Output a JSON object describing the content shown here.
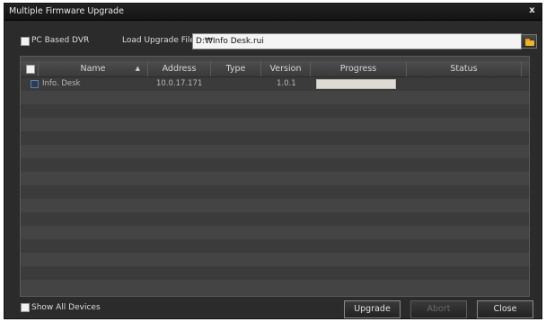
{
  "window": {
    "title": "Multiple Firmware Upgrade",
    "close_glyph": "x"
  },
  "options": {
    "pc_based_dvr_label": "PC Based DVR",
    "pc_based_dvr_checked": false,
    "load_file_label": "Load Upgrade File :",
    "load_file_value": "D:₩Info Desk.rui"
  },
  "table": {
    "columns": [
      "Name",
      "Address",
      "Type",
      "Version",
      "Progress",
      "Status"
    ],
    "rows": [
      {
        "name": "Info. Desk",
        "address": "10.0.17.171",
        "type": "",
        "version": "1.0.1",
        "progress": 0,
        "status": ""
      }
    ]
  },
  "footer": {
    "show_all_label": "Show All Devices",
    "show_all_checked": false,
    "upgrade_label": "Upgrade",
    "abort_label": "Abort",
    "close_label": "Close"
  },
  "icons": {
    "browse": "folder-icon",
    "sort": "sort-ascending-icon"
  }
}
